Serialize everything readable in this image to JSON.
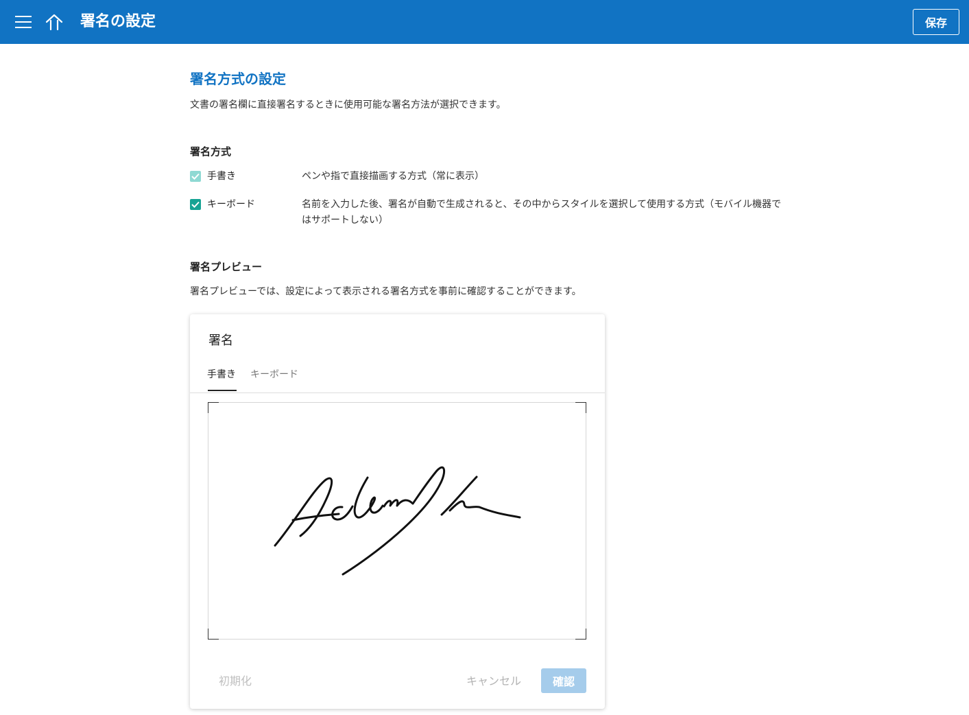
{
  "header": {
    "title": "署名の設定",
    "save_label": "保存",
    "bar_color": "#1173c3"
  },
  "section": {
    "title": "署名方式の設定",
    "description": "文書の署名欄に直接署名するときに使用可能な署名方法が選択できます。"
  },
  "methods": {
    "heading": "署名方式",
    "options": [
      {
        "label": "手書き",
        "description": "ペンや指で直接描画する方式（常に表示）",
        "checked": true,
        "disabled": true
      },
      {
        "label": "キーボード",
        "description": "名前を入力した後、署名が自動で生成されると、その中からスタイルを選択して使用する方式（モバイル機器ではサポートしない）",
        "checked": true,
        "disabled": false
      }
    ],
    "check_color": "#16a394"
  },
  "preview": {
    "heading": "署名プレビュー",
    "description": "署名プレビューでは、設定によって表示される署名方式を事前に確認することができます。"
  },
  "dialog": {
    "title": "署名",
    "tabs": [
      "手書き",
      "キーボード"
    ],
    "active_tab": "手書き",
    "reset_label": "初期化",
    "cancel_label": "キャンセル",
    "confirm_label": "確認",
    "confirm_color": "#a5cceb"
  },
  "icons": [
    "menu-icon",
    "home-icon",
    "check-icon"
  ]
}
